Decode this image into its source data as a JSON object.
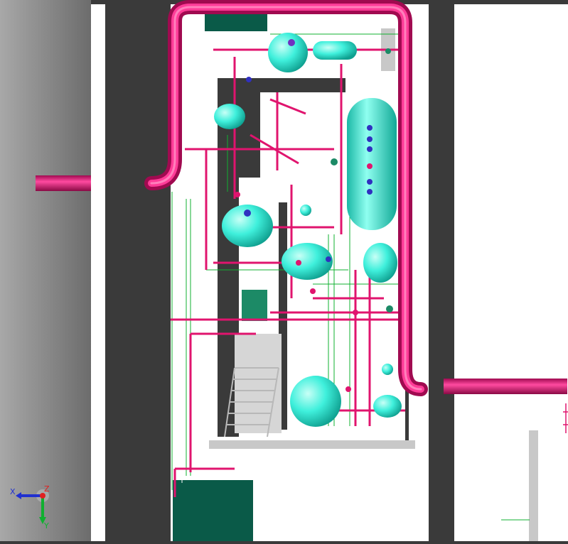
{
  "view": {
    "type": "3D piping model view",
    "colors": {
      "background": "#ffffff",
      "wall_dark": "#3a3a3a",
      "floor_grey": "#c8c8c8",
      "pipe_magenta": "#e0146e",
      "vessel_cyan": "#3ff0dc",
      "equipment_green": "#0a5a48",
      "line_green": "#10b030",
      "valve_blue": "#3030c0"
    }
  },
  "axis_triad": {
    "x_label": "X",
    "y_label": "Y",
    "z_label": "Z"
  }
}
